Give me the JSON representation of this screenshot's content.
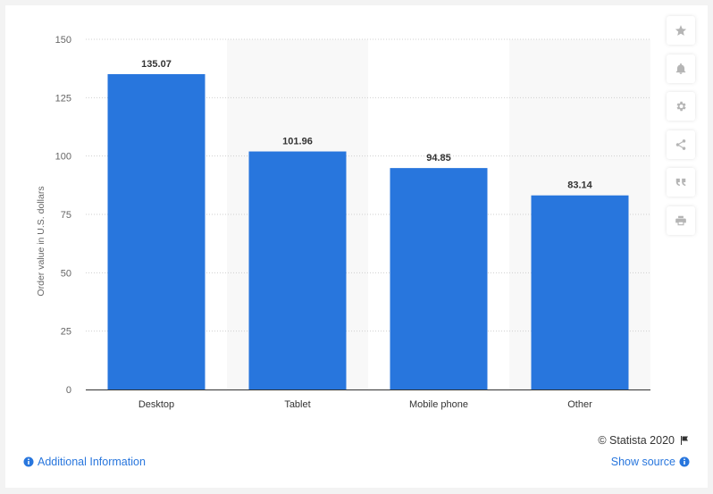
{
  "chart_data": {
    "type": "bar",
    "categories": [
      "Desktop",
      "Tablet",
      "Mobile phone",
      "Other"
    ],
    "values": [
      135.07,
      101.96,
      94.85,
      83.14
    ],
    "value_labels": [
      "135.07",
      "101.96",
      "94.85",
      "83.14"
    ],
    "ylabel": "Order value in U.S. dollars",
    "ylim": [
      0,
      150
    ],
    "yticks": [
      "0",
      "25",
      "50",
      "75",
      "100",
      "125",
      "150"
    ],
    "grid": "horizontal-dotted",
    "bar_color": "#2876dd",
    "alternate_band_color": "#f8f8f8"
  },
  "toolbar": {
    "icons": [
      "star-icon",
      "bell-icon",
      "gear-icon",
      "share-icon",
      "quote-icon",
      "print-icon"
    ]
  },
  "footer": {
    "copyright": "© Statista 2020",
    "additional_info": "Additional Information",
    "show_source": "Show source"
  },
  "colors": {
    "link": "#2876dd",
    "icon": "#b5b5b5"
  }
}
